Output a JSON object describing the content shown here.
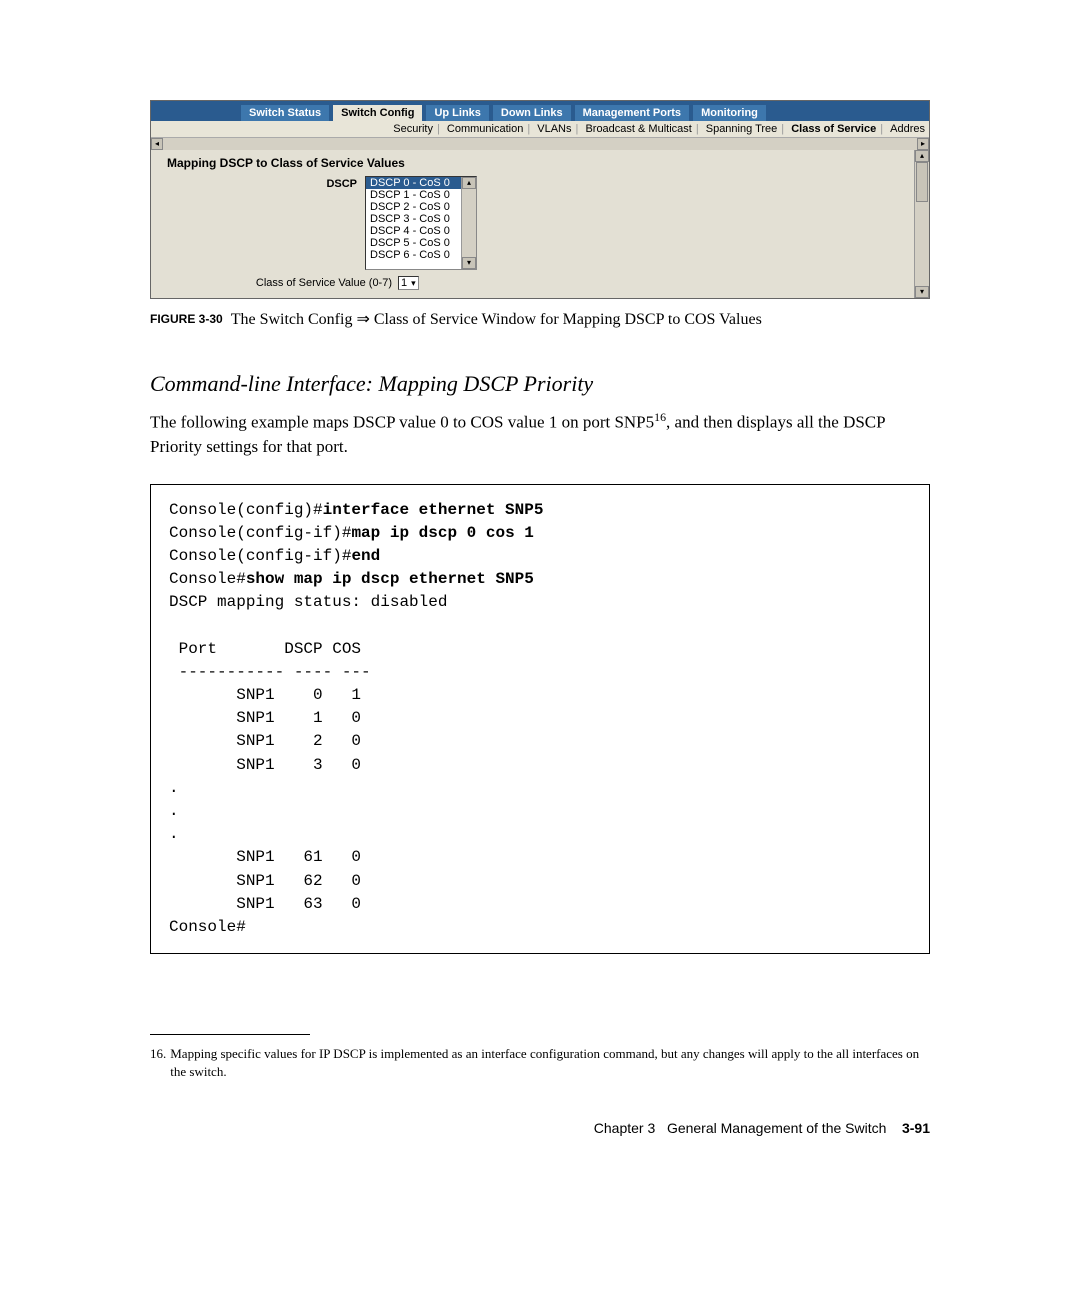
{
  "screenshot": {
    "tabs": [
      "Switch Status",
      "Switch Config",
      "Up Links",
      "Down Links",
      "Management Ports",
      "Monitoring"
    ],
    "active_tab_index": 1,
    "subtabs": [
      "Security",
      "Communication",
      "VLANs",
      "Broadcast & Multicast",
      "Spanning Tree",
      "Class of Service",
      "Addres"
    ],
    "active_subtab_index": 5,
    "section_title": "Mapping DSCP to Class of Service Values",
    "dscp_label": "DSCP",
    "dscp_options": [
      "DSCP 0 - CoS 0",
      "DSCP 1 - CoS 0",
      "DSCP 2 - CoS 0",
      "DSCP 3 - CoS 0",
      "DSCP 4 - CoS 0",
      "DSCP 5 - CoS 0",
      "DSCP 6 - CoS 0"
    ],
    "dscp_selected_index": 0,
    "cos_label": "Class of Service Value (0-7)",
    "cos_value": "1"
  },
  "figure": {
    "number": "FIGURE 3-30",
    "text": "The Switch Config ⇒ Class of Service Window for Mapping DSCP to COS Values"
  },
  "cli_heading": "Command-line Interface: Mapping DSCP Priority",
  "body_para_pre": "The following example maps DSCP value 0 to COS value 1 on port SNP5",
  "body_para_sup": "16",
  "body_para_post": ", and then displays all the DSCP Priority settings for that port.",
  "code": {
    "l1a": "Console(config)#",
    "l1b": "interface ethernet SNP5",
    "l2a": "Console(config-if)#",
    "l2b": "map ip dscp 0 cos 1",
    "l3a": "Console(config-if)#",
    "l3b": "end",
    "l4a": "Console#",
    "l4b": "show map ip dscp ethernet SNP5",
    "l5": "DSCP mapping status: disabled",
    "l6": "",
    "l7": " Port       DSCP COS",
    "l8": " ----------- ---- ---",
    "l9": "       SNP1    0   1",
    "l10": "       SNP1    1   0",
    "l11": "       SNP1    2   0",
    "l12": "       SNP1    3   0",
    "l13": ".",
    "l14": ".",
    "l15": ".",
    "l16": "       SNP1   61   0",
    "l17": "       SNP1   62   0",
    "l18": "       SNP1   63   0",
    "l19": "Console#"
  },
  "footnote": {
    "num": "16.",
    "text": "Mapping specific values for IP DSCP is implemented as an interface configuration command, but any changes will apply to the all interfaces on the switch."
  },
  "footer": {
    "chapter": "Chapter 3",
    "title": "General Management of the Switch",
    "page": "3-91"
  }
}
